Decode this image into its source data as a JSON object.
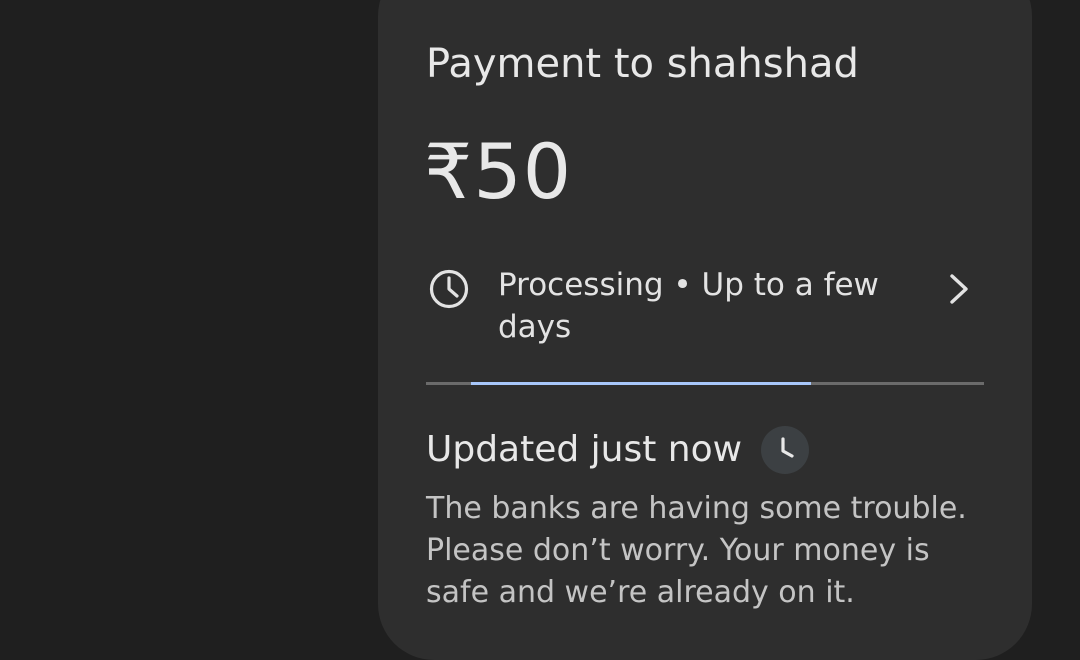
{
  "payment": {
    "title": "Payment to shahshad",
    "amount": "₹50"
  },
  "status": {
    "icon": "clock-icon",
    "text": "Processing • Up to a few days",
    "chevron_icon": "chevron-right-icon",
    "progress_start_fraction": 0.08,
    "progress_end_fraction": 0.69
  },
  "update": {
    "label": "Updated just now",
    "icon": "clock-badge-icon",
    "message": "The banks are having some trouble. Please don’t worry. Your money is safe and we’re already on it."
  },
  "colors": {
    "background": "#1f1f1f",
    "card": "#2e2e2e",
    "progress_fill": "#a8c7fa",
    "progress_track": "#6b6b6b"
  }
}
